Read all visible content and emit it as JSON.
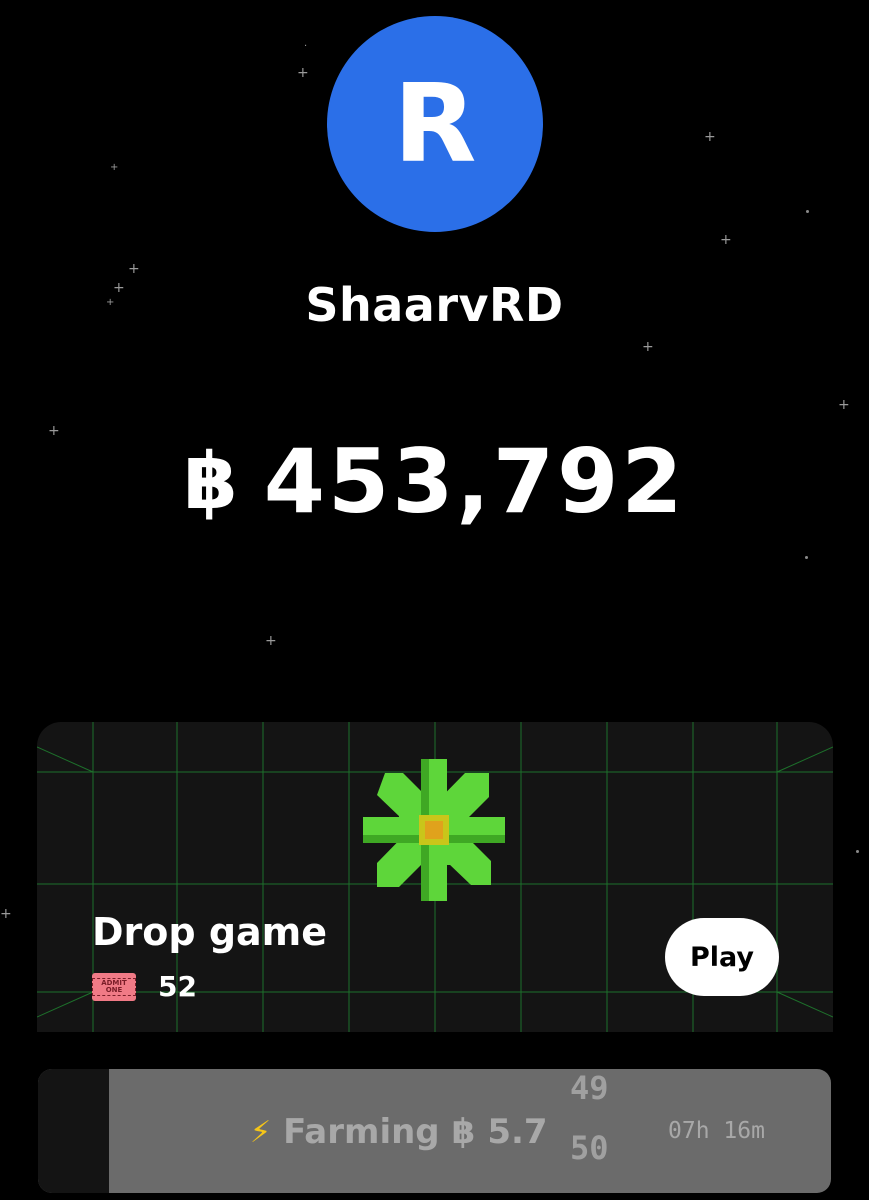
{
  "profile": {
    "avatar_letter": "R",
    "username": "ShaarvRD",
    "avatar_color": "#2b6fe8"
  },
  "balance": {
    "currency_icon": "฿",
    "amount": "453,792"
  },
  "game_card": {
    "title": "Drop game",
    "ticket_icon_text": "ADMIT ONE",
    "ticket_count": "52",
    "play_label": "Play",
    "grid_color": "#1f7a2e",
    "mascot_color": "#5ed63a"
  },
  "farming": {
    "icon": "⚡",
    "label": "Farming",
    "currency_icon": "฿",
    "amount": "5.7",
    "rolling_top": "49",
    "rolling_bottom": "50",
    "time_left": "07h 16m",
    "progress_fraction": 0.09
  },
  "colors": {
    "background": "#000000",
    "card_background": "#141414",
    "farming_fill": "#6b6b6b"
  }
}
